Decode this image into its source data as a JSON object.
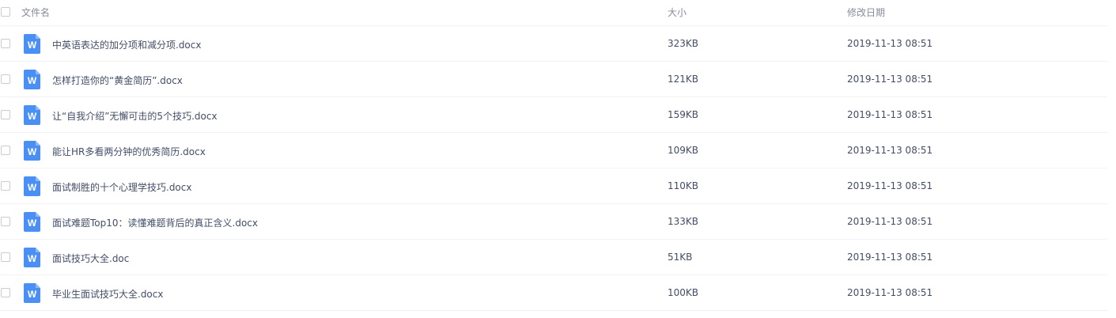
{
  "header": {
    "name_label": "文件名",
    "size_label": "大小",
    "date_label": "修改日期"
  },
  "colors": {
    "word_icon": "#4a8ff4",
    "text": "#424e67",
    "header_text": "#878c9c",
    "divider": "#f1f2f4"
  },
  "files": [
    {
      "name": "中英语表达的加分项和减分项.docx",
      "size": "323KB",
      "date": "2019-11-13 08:51",
      "icon": "word-doc-icon"
    },
    {
      "name": "怎样打造你的“黄金简历”.docx",
      "size": "121KB",
      "date": "2019-11-13 08:51",
      "icon": "word-doc-icon"
    },
    {
      "name": "让“自我介绍”无懈可击的5个技巧.docx",
      "size": "159KB",
      "date": "2019-11-13 08:51",
      "icon": "word-doc-icon"
    },
    {
      "name": "能让HR多看两分钟的优秀简历.docx",
      "size": "109KB",
      "date": "2019-11-13 08:51",
      "icon": "word-doc-icon"
    },
    {
      "name": "面试制胜的十个心理学技巧.docx",
      "size": "110KB",
      "date": "2019-11-13 08:51",
      "icon": "word-doc-icon"
    },
    {
      "name": "面试难题Top10：读懂难题背后的真正含义.docx",
      "size": "133KB",
      "date": "2019-11-13 08:51",
      "icon": "word-doc-icon"
    },
    {
      "name": "面试技巧大全.doc",
      "size": "51KB",
      "date": "2019-11-13 08:51",
      "icon": "word-doc-icon"
    },
    {
      "name": "毕业生面试技巧大全.docx",
      "size": "100KB",
      "date": "2019-11-13 08:51",
      "icon": "word-doc-icon"
    }
  ]
}
